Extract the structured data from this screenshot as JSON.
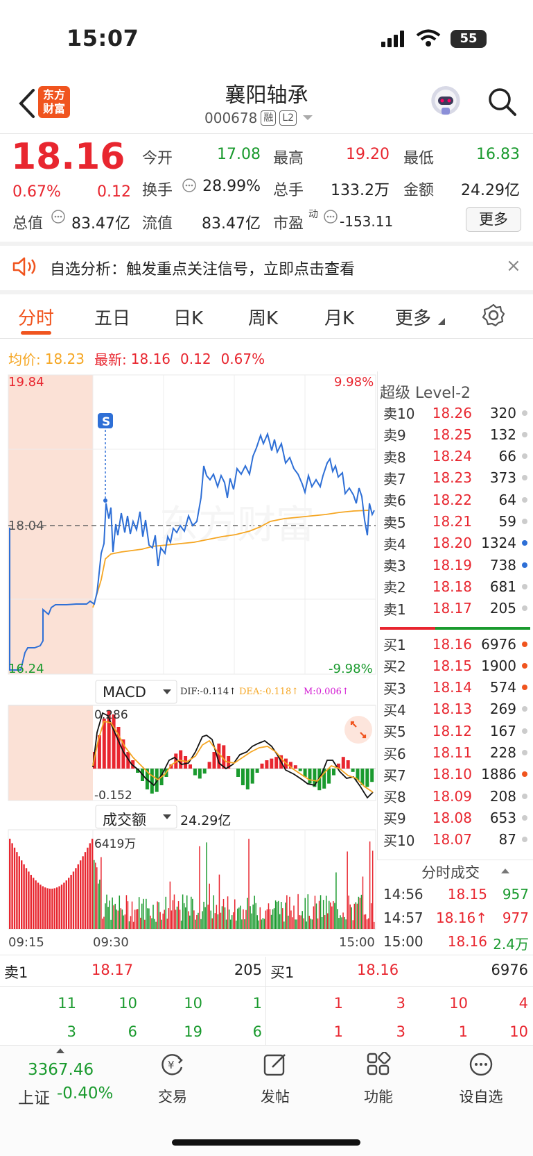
{
  "status_bar": {
    "time": "15:07",
    "battery": "55"
  },
  "header": {
    "logo_line1": "东方",
    "logo_line2": "财富",
    "stock_name": "襄阳轴承",
    "stock_code": "000678",
    "tag_margin": "融",
    "tag_level": "L2"
  },
  "quote": {
    "price": "18.16",
    "pct": "0.67%",
    "chg": "0.12",
    "open_label": "今开",
    "open": "17.08",
    "high_label": "最高",
    "high": "19.20",
    "low_label": "最低",
    "low": "16.83",
    "turnover_label": "换手",
    "turnover": "28.99%",
    "volume_label": "总手",
    "volume": "133.2万",
    "amount_label": "金额",
    "amount": "24.29亿",
    "mktcap_label": "总值",
    "mktcap": "83.47亿",
    "float_label": "流值",
    "float": "83.47亿",
    "pe_label": "市盈",
    "pe_sup": "动",
    "pe": "-153.11",
    "more_label": "更多"
  },
  "notice": {
    "text": "自选分析：触发重点关注信号，立即点击查看",
    "close": "×"
  },
  "tabs": [
    "分时",
    "五日",
    "日K",
    "周K",
    "月K",
    "更多"
  ],
  "avg_row": {
    "avg_label": "均价:",
    "avg": "18.23",
    "latest_label": "最新:",
    "latest": "18.16",
    "chg": "0.12",
    "pct": "0.67%"
  },
  "chart": {
    "price_top": "19.84",
    "price_mid": "18.04",
    "price_bottom": "16.24",
    "pct_top": "9.98%",
    "pct_bottom": "-9.98%",
    "marker": "S",
    "watermark": "东方财富",
    "macd_select": "MACD",
    "dif": "DIF:-0.114↑",
    "dea": "DEA:-0.118↑",
    "m": "M:0.006↑",
    "macd_top": "0.286",
    "macd_bottom": "-0.152",
    "vol_select": "成交额",
    "vol_amount": "24.29亿",
    "vol_top": "6419万",
    "time_start": "09:15",
    "time_open": "09:30",
    "time_end": "15:00"
  },
  "level2": {
    "title": "超级 Level-2",
    "asks": [
      {
        "label": "卖10",
        "price": "18.26",
        "vol": "320",
        "dot": "#cccccc"
      },
      {
        "label": "卖9",
        "price": "18.25",
        "vol": "132",
        "dot": "#cccccc"
      },
      {
        "label": "卖8",
        "price": "18.24",
        "vol": "66",
        "dot": "#cccccc"
      },
      {
        "label": "卖7",
        "price": "18.23",
        "vol": "373",
        "dot": "#cccccc"
      },
      {
        "label": "卖6",
        "price": "18.22",
        "vol": "64",
        "dot": "#cccccc"
      },
      {
        "label": "卖5",
        "price": "18.21",
        "vol": "59",
        "dot": "#cccccc"
      },
      {
        "label": "卖4",
        "price": "18.20",
        "vol": "1324",
        "dot": "#2e6fd6"
      },
      {
        "label": "卖3",
        "price": "18.19",
        "vol": "738",
        "dot": "#2e6fd6"
      },
      {
        "label": "卖2",
        "price": "18.18",
        "vol": "681",
        "dot": "#cccccc"
      },
      {
        "label": "卖1",
        "price": "18.17",
        "vol": "205",
        "dot": "#cccccc"
      }
    ],
    "bids": [
      {
        "label": "买1",
        "price": "18.16",
        "vol": "6976",
        "dot": "#f0541e"
      },
      {
        "label": "买2",
        "price": "18.15",
        "vol": "1900",
        "dot": "#f0541e"
      },
      {
        "label": "买3",
        "price": "18.14",
        "vol": "574",
        "dot": "#f0541e"
      },
      {
        "label": "买4",
        "price": "18.13",
        "vol": "269",
        "dot": "#cccccc"
      },
      {
        "label": "买5",
        "price": "18.12",
        "vol": "167",
        "dot": "#cccccc"
      },
      {
        "label": "买6",
        "price": "18.11",
        "vol": "228",
        "dot": "#cccccc"
      },
      {
        "label": "买7",
        "price": "18.10",
        "vol": "1886",
        "dot": "#f0541e"
      },
      {
        "label": "买8",
        "price": "18.09",
        "vol": "208",
        "dot": "#cccccc"
      },
      {
        "label": "买9",
        "price": "18.08",
        "vol": "653",
        "dot": "#cccccc"
      },
      {
        "label": "买10",
        "price": "18.07",
        "vol": "87",
        "dot": "#cccccc"
      }
    ],
    "ticks_title": "分时成交",
    "ticks": [
      {
        "time": "14:56",
        "price": "18.15",
        "vol": "957"
      },
      {
        "time": "14:57",
        "price": "18.16↑",
        "vol": "977"
      },
      {
        "time": "15:00",
        "price": "18.16",
        "vol": "2.4万"
      }
    ]
  },
  "bottom_book": {
    "sell_label": "卖1",
    "sell_price": "18.17",
    "sell_vol": "205",
    "buy_label": "买1",
    "buy_price": "18.16",
    "buy_vol": "6976",
    "sell_queue": [
      [
        "11",
        "10",
        "10",
        "1"
      ],
      [
        "3",
        "6",
        "19",
        "6"
      ]
    ],
    "buy_queue": [
      [
        "1",
        "3",
        "10",
        "4"
      ],
      [
        "1",
        "3",
        "1",
        "10"
      ]
    ]
  },
  "bottom_nav": {
    "index_value": "3367.46",
    "index_name": "上证",
    "index_pct": "-0.40%",
    "items": [
      "交易",
      "发帖",
      "功能",
      "设自选"
    ]
  },
  "colors": {
    "up": "#e8262f",
    "down": "#1a9a2e",
    "brand": "#f0541e",
    "line": "#2e6fd6",
    "avg": "#f5a623"
  }
}
